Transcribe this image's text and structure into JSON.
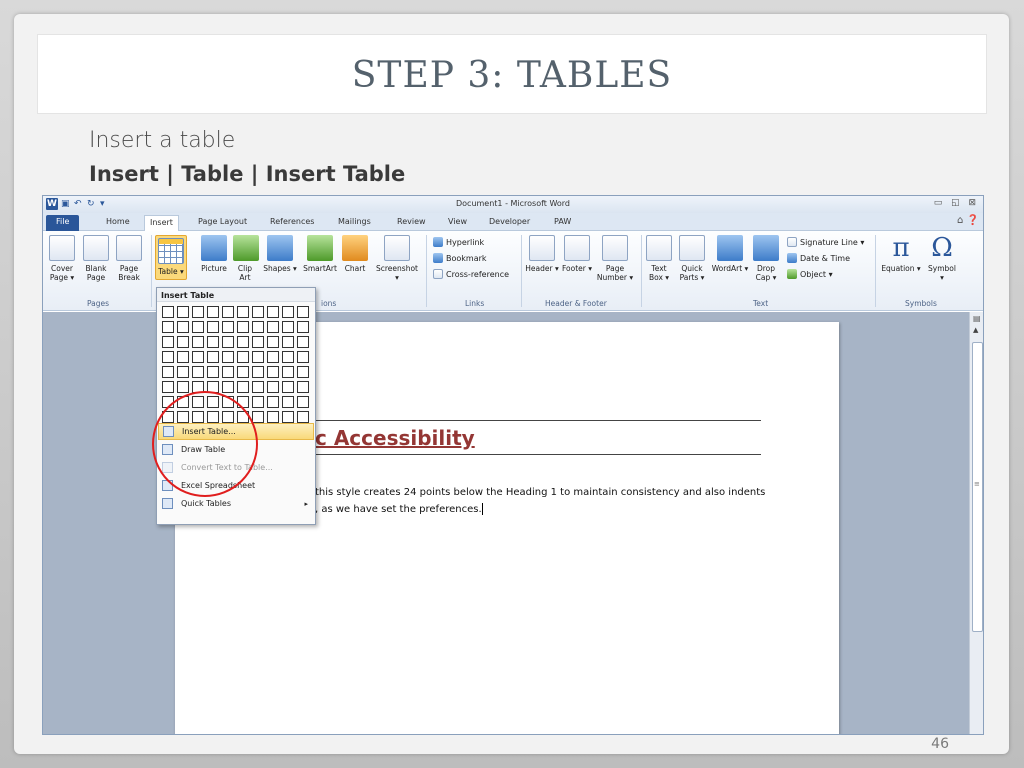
{
  "slide": {
    "title": "STEP 3: TABLES",
    "subtitle": "Insert a table",
    "path": "Insert | Table | Insert Table",
    "page_number": "46"
  },
  "word": {
    "app_icon": "W",
    "window_title": "Document1 - Microsoft Word",
    "window_controls": "▭ ◱ ⊠",
    "tab_right_icons": "⌂ ❓",
    "tabs": [
      {
        "label": "File"
      },
      {
        "label": "Home"
      },
      {
        "label": "Insert"
      },
      {
        "label": "Page Layout"
      },
      {
        "label": "References"
      },
      {
        "label": "Mailings"
      },
      {
        "label": "Review"
      },
      {
        "label": "View"
      },
      {
        "label": "Developer"
      },
      {
        "label": "PAW"
      }
    ],
    "ribbon": {
      "cover_page": "Cover Page ▾",
      "blank_page": "Blank Page",
      "page_break": "Page Break",
      "table": "Table ▾",
      "picture": "Picture",
      "clip_art": "Clip Art",
      "shapes": "Shapes ▾",
      "smartart": "SmartArt",
      "chart": "Chart",
      "screenshot": "Screenshot ▾",
      "hyperlink": "Hyperlink",
      "bookmark": "Bookmark",
      "cross_reference": "Cross-reference",
      "header": "Header ▾",
      "footer": "Footer ▾",
      "page_number": "Page Number ▾",
      "text_box": "Text Box ▾",
      "quick_parts": "Quick Parts ▾",
      "wordart": "WordArt ▾",
      "drop_cap": "Drop Cap ▾",
      "signature_line": "Signature Line ▾",
      "date_time": "Date & Time",
      "object": "Object ▾",
      "equation": "Equation ▾",
      "symbol": "Symbol ▾",
      "equation_glyph": "π",
      "symbol_glyph": "Ω",
      "groups": {
        "pages": "Pages",
        "illustrations": "ions",
        "links": "Links",
        "header_footer": "Header & Footer",
        "text": "Text",
        "symbols": "Symbols"
      }
    },
    "dropdown": {
      "header": "Insert Table",
      "items": [
        {
          "label": "Insert Table..."
        },
        {
          "label": "Draw Table"
        },
        {
          "label": "Convert Text to Table..."
        },
        {
          "label": "Excel Spreadsheet"
        },
        {
          "label": "Quick Tables"
        }
      ],
      "submenu_arrow": "▸"
    },
    "document": {
      "heading": "c Accessibility",
      "paragraph_line1": "this style creates 24 points below the Heading 1 to maintain consistency and also indents",
      "paragraph_line2": ", as we have set the preferences."
    }
  }
}
